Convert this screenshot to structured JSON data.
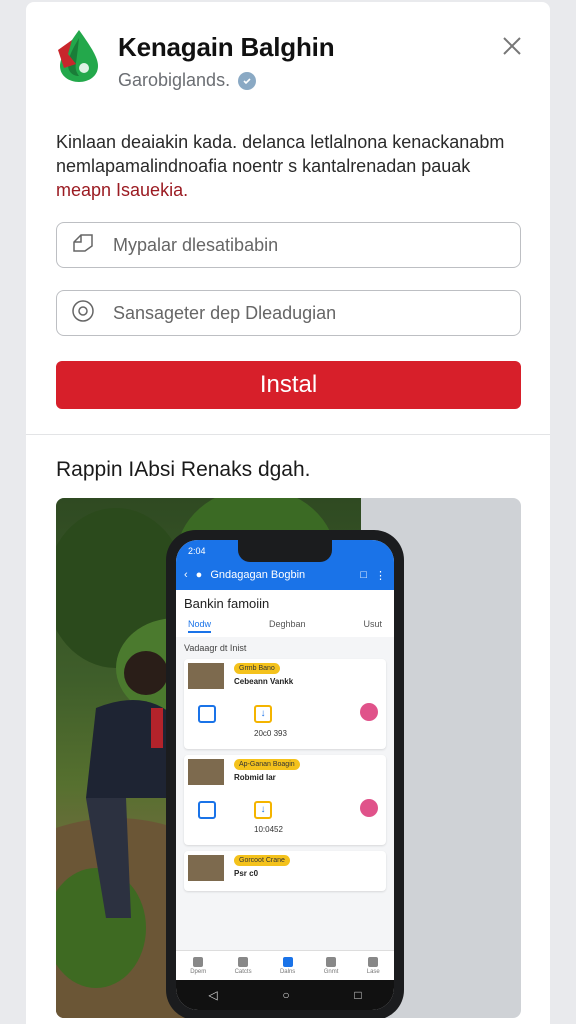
{
  "app": {
    "title": "Kenagain Balghin",
    "developer": "Garobiglands.",
    "brand_color": "#d71f2a"
  },
  "header": {
    "close_icon": "close-icon",
    "verified_icon": "verified-badge-icon"
  },
  "description": {
    "text": "Kinlaan deaiakin kada. delanca letlalnona kenackanabm nemlapamalindnoafia noentr s kantalrenadan pauak",
    "link_text": "meapn Isauekia."
  },
  "fields": {
    "field1_placeholder": "Mypalar dlesatibabin",
    "field2_placeholder": "Sansageter dep Dleadugian"
  },
  "install": {
    "label": "Instal"
  },
  "screenshots": {
    "title": "Rappin IAbsi Renaks dgah."
  },
  "phone": {
    "time": "2:04",
    "app_name": "Gndagagan Bogbin",
    "page_title": "Bankin famoiin",
    "tabs": [
      "Nodw",
      "Deghban",
      "Usut"
    ],
    "list_header": "Vadaagr dt Inist",
    "items": [
      {
        "badge": "Grmb Bano",
        "name": "Cebeann Vankk",
        "value": "20c0 393"
      },
      {
        "badge": "Ap-Ganan Boagin",
        "name": "Robmid Iar",
        "value": "10:0452"
      },
      {
        "badge": "Gorcoot Crane",
        "name": "Psr c0",
        "value": ""
      }
    ],
    "nav": [
      "Dpem",
      "Catcts",
      "Dalns",
      "Gnmt",
      "Lase"
    ]
  }
}
